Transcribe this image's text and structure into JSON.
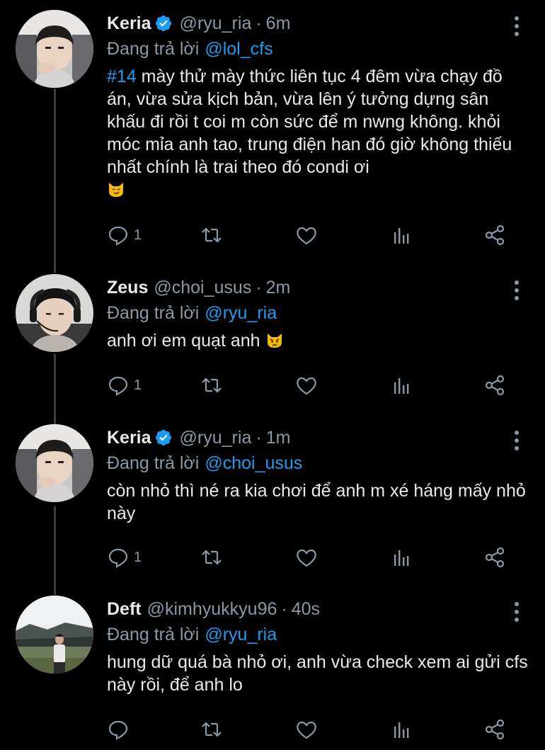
{
  "colors": {
    "background": "#000000",
    "text_primary": "#e7e9ea",
    "text_secondary": "#8b98a5",
    "accent": "#1d9bf0",
    "thread_line": "#3a3f44"
  },
  "tweets": [
    {
      "name": "Keria",
      "verified": true,
      "handle": "@ryu_ria",
      "sep": "·",
      "time": "6m",
      "replying_label": "Đang trả lời",
      "replying_to": "@lol_cfs",
      "hashtag": "#14",
      "text": " mày thử mày thức liên tục 4 đêm vừa chạy đồ án, vừa sửa kịch bản, vừa lên ý tưởng dựng sân khấu đi rồi t coi m còn sức để m nwng không. khỏi móc mỉa anh tao, trung điện han đó giờ không thiếu nhất chính là trai theo đó condi ơi",
      "emoji": "cat-smirk-emoji",
      "reply_count": "1",
      "avatar": "avatar-keria"
    },
    {
      "name": "Zeus",
      "verified": false,
      "handle": "@choi_usus",
      "sep": "·",
      "time": "2m",
      "replying_label": "Đang trả lời",
      "replying_to": "@ryu_ria",
      "text": "anh ơi em quạt anh",
      "emoji": "cat-angry-emoji",
      "reply_count": "1",
      "avatar": "avatar-zeus"
    },
    {
      "name": "Keria",
      "verified": true,
      "handle": "@ryu_ria",
      "sep": "·",
      "time": "1m",
      "replying_label": "Đang trả lời",
      "replying_to": "@choi_usus",
      "text": "còn nhỏ thì né ra kia chơi để anh m xé háng mấy nhỏ này",
      "reply_count": "1",
      "avatar": "avatar-keria"
    },
    {
      "name": "Deft",
      "verified": false,
      "handle": "@kimhyukkyu96",
      "sep": "·",
      "time": "40s",
      "replying_label": "Đang trả lời",
      "replying_to": "@ryu_ria",
      "text": "hung dữ quá bà nhỏ ơi, anh vừa check xem ai gửi cfs này rồi, để anh lo",
      "reply_count": "",
      "avatar": "avatar-deft"
    }
  ]
}
